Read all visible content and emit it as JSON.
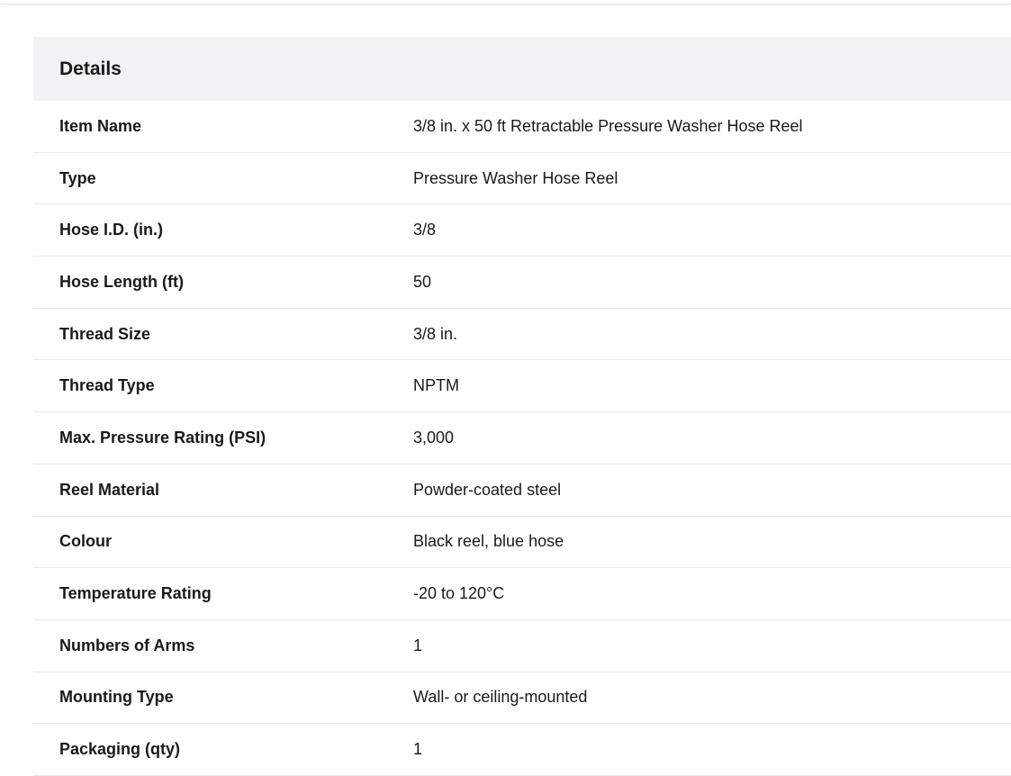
{
  "details": {
    "title": "Details",
    "rows": [
      {
        "label": "Item Name",
        "value": "3/8 in. x 50 ft Retractable Pressure Washer Hose Reel"
      },
      {
        "label": "Type",
        "value": "Pressure Washer Hose Reel"
      },
      {
        "label": "Hose I.D. (in.)",
        "value": "3/8"
      },
      {
        "label": "Hose Length (ft)",
        "value": "50"
      },
      {
        "label": "Thread Size",
        "value": "3/8 in."
      },
      {
        "label": "Thread Type",
        "value": "NPTM"
      },
      {
        "label": "Max. Pressure Rating (PSI)",
        "value": "3,000"
      },
      {
        "label": "Reel Material",
        "value": "Powder-coated steel"
      },
      {
        "label": "Colour",
        "value": "Black reel, blue hose"
      },
      {
        "label": "Temperature Rating",
        "value": "-20 to 120°C"
      },
      {
        "label": "Numbers of Arms",
        "value": "1"
      },
      {
        "label": "Mounting Type",
        "value": "Wall- or ceiling-mounted"
      },
      {
        "label": "Packaging (qty)",
        "value": "1"
      }
    ]
  },
  "colors": {
    "header_bg": "#f1f2f3",
    "row_divider": "#e8e8e8",
    "text": "#1a1a1a"
  }
}
